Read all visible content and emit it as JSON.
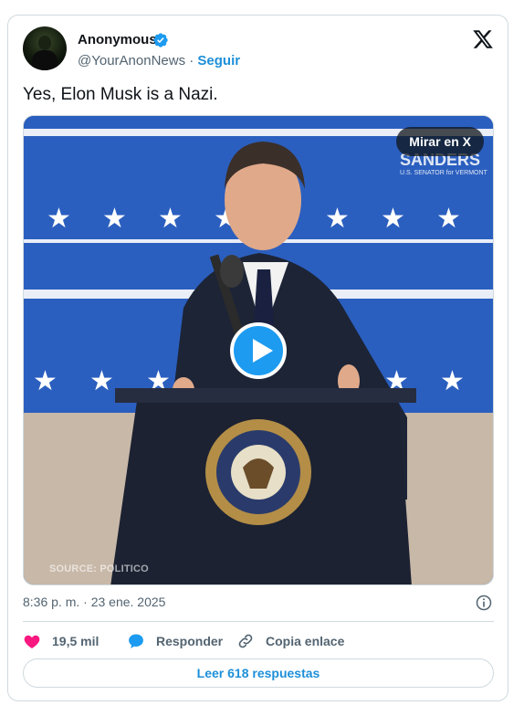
{
  "author": {
    "name": "Anonymous",
    "handle": "@YourAnonNews",
    "separator": "·",
    "follow_label": "Seguir"
  },
  "tweet": {
    "text": "Yes, Elon Musk is a Nazi.",
    "timestamp": "8:36 p. m. · 23 ene. 2025"
  },
  "media": {
    "watch_label": "Mirar en X",
    "source_label": "SOURCE: POLITICO",
    "backdrop_text_1": "SANDERS",
    "backdrop_text_2": "U.S. SENATOR for VERMONT"
  },
  "actions": {
    "likes": "19,5 mil",
    "reply_label": "Responder",
    "copy_label": "Copia enlace"
  },
  "footer": {
    "read_replies_label": "Leer 618 respuestas"
  },
  "colors": {
    "accent": "#1d9bf0",
    "link": "#1d8fd8",
    "like": "#f91880",
    "text_secondary": "#536471",
    "border": "#cfd9de"
  },
  "icons": {
    "verified": "verified-badge-icon",
    "logo": "x-logo-icon",
    "info": "info-icon",
    "like": "heart-icon",
    "reply": "speech-bubble-icon",
    "copy": "link-icon",
    "play": "play-icon"
  }
}
